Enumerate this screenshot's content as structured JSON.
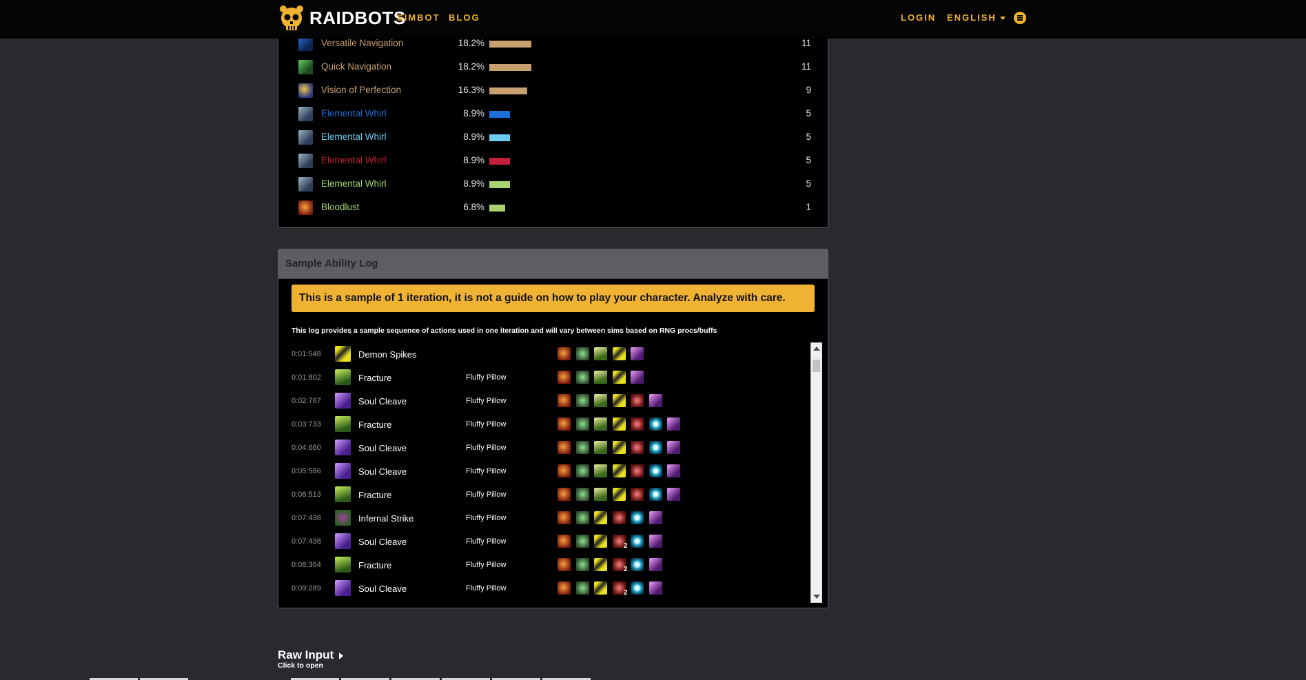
{
  "nav": {
    "brand": "RAIDBOTS",
    "links": [
      "SIMBOT",
      "BLOG"
    ],
    "login": "LOGIN",
    "language": "ENGLISH"
  },
  "buffs": [
    {
      "name": "Versatile Navigation",
      "pct": "18.2%",
      "pct_value": 18.2,
      "count": "11",
      "color": "#c8a070",
      "bar": "#c8a070",
      "icon": "ic-blue"
    },
    {
      "name": "Quick Navigation",
      "pct": "18.2%",
      "pct_value": 18.2,
      "count": "11",
      "color": "#c8a070",
      "bar": "#c8a070",
      "icon": "ic-green"
    },
    {
      "name": "Vision of Perfection",
      "pct": "16.3%",
      "pct_value": 16.3,
      "count": "9",
      "color": "#c8a070",
      "bar": "#c8a070",
      "icon": "ic-swirl"
    },
    {
      "name": "Elemental Whirl",
      "pct": "8.9%",
      "pct_value": 8.9,
      "count": "5",
      "color": "#1a70d8",
      "bar": "#1a70d8",
      "icon": "ic-whirl"
    },
    {
      "name": "Elemental Whirl",
      "pct": "8.9%",
      "pct_value": 8.9,
      "count": "5",
      "color": "#69ccf0",
      "bar": "#69ccf0",
      "icon": "ic-whirl"
    },
    {
      "name": "Elemental Whirl",
      "pct": "8.9%",
      "pct_value": 8.9,
      "count": "5",
      "color": "#c41e3a",
      "bar": "#c41e3a",
      "icon": "ic-whirl"
    },
    {
      "name": "Elemental Whirl",
      "pct": "8.9%",
      "pct_value": 8.9,
      "count": "5",
      "color": "#a9d271",
      "bar": "#a9d271",
      "icon": "ic-whirl"
    },
    {
      "name": "Bloodlust",
      "pct": "6.8%",
      "pct_value": 6.8,
      "count": "1",
      "color": "#a9d271",
      "bar": "#a9d271",
      "icon": "ic-lust"
    }
  ],
  "log": {
    "title": "Sample Ability Log",
    "warning": "This is a sample of 1 iteration, it is not a guide on how to play your character. Analyze with care.",
    "note": "This log provides a sample sequence of actions used in one iteration and will vary between sims based on RNG procs/buffs",
    "rows": [
      {
        "time": "0:01:548",
        "name": "Demon Spikes",
        "target": "",
        "icon": "ic-spikes",
        "buffs": [
          "b-lust",
          "b-nav",
          "b-tree",
          "b-spike",
          "b-purple"
        ],
        "stacks": {}
      },
      {
        "time": "0:01:802",
        "name": "Fracture",
        "target": "Fluffy Pillow",
        "icon": "ic-fracture",
        "buffs": [
          "b-lust",
          "b-nav",
          "b-tree",
          "b-spike",
          "b-purple"
        ],
        "stacks": {}
      },
      {
        "time": "0:02:767",
        "name": "Soul Cleave",
        "target": "Fluffy Pillow",
        "icon": "ic-cleave",
        "buffs": [
          "b-lust",
          "b-nav",
          "b-tree",
          "b-spike",
          "b-demon",
          "b-purple"
        ],
        "stacks": {}
      },
      {
        "time": "0:03:733",
        "name": "Fracture",
        "target": "Fluffy Pillow",
        "icon": "ic-fracture",
        "buffs": [
          "b-lust",
          "b-nav",
          "b-tree",
          "b-spike",
          "b-demon",
          "b-eye",
          "b-purple"
        ],
        "stacks": {}
      },
      {
        "time": "0:04:660",
        "name": "Soul Cleave",
        "target": "Fluffy Pillow",
        "icon": "ic-cleave",
        "buffs": [
          "b-lust",
          "b-nav",
          "b-tree",
          "b-spike",
          "b-demon",
          "b-eye",
          "b-purple"
        ],
        "stacks": {}
      },
      {
        "time": "0:05:586",
        "name": "Soul Cleave",
        "target": "Fluffy Pillow",
        "icon": "ic-cleave",
        "buffs": [
          "b-lust",
          "b-nav",
          "b-tree",
          "b-spike",
          "b-demon",
          "b-eye",
          "b-purple"
        ],
        "stacks": {}
      },
      {
        "time": "0:06:513",
        "name": "Fracture",
        "target": "Fluffy Pillow",
        "icon": "ic-fracture",
        "buffs": [
          "b-lust",
          "b-nav",
          "b-tree",
          "b-spike",
          "b-demon",
          "b-eye",
          "b-purple"
        ],
        "stacks": {}
      },
      {
        "time": "0:07:438",
        "name": "Infernal Strike",
        "target": "Fluffy Pillow",
        "icon": "ic-infernal",
        "buffs": [
          "b-lust",
          "b-nav",
          "b-spike",
          "b-demon",
          "b-eye",
          "b-purple"
        ],
        "stacks": {}
      },
      {
        "time": "0:07:438",
        "name": "Soul Cleave",
        "target": "Fluffy Pillow",
        "icon": "ic-cleave",
        "buffs": [
          "b-lust",
          "b-nav",
          "b-spike",
          "b-demon",
          "b-eye",
          "b-purple"
        ],
        "stacks": {
          "3": "2"
        }
      },
      {
        "time": "0:08:364",
        "name": "Fracture",
        "target": "Fluffy Pillow",
        "icon": "ic-fracture",
        "buffs": [
          "b-lust",
          "b-nav",
          "b-spike",
          "b-demon",
          "b-eye",
          "b-purple"
        ],
        "stacks": {
          "3": "2"
        }
      },
      {
        "time": "0:09:289",
        "name": "Soul Cleave",
        "target": "Fluffy Pillow",
        "icon": "ic-cleave",
        "buffs": [
          "b-lust",
          "b-nav",
          "b-spike",
          "b-demon",
          "b-eye",
          "b-purple"
        ],
        "stacks": {
          "3": "2"
        }
      }
    ]
  },
  "raw_input": {
    "title": "Raw Input",
    "subtitle": "Click to open"
  }
}
